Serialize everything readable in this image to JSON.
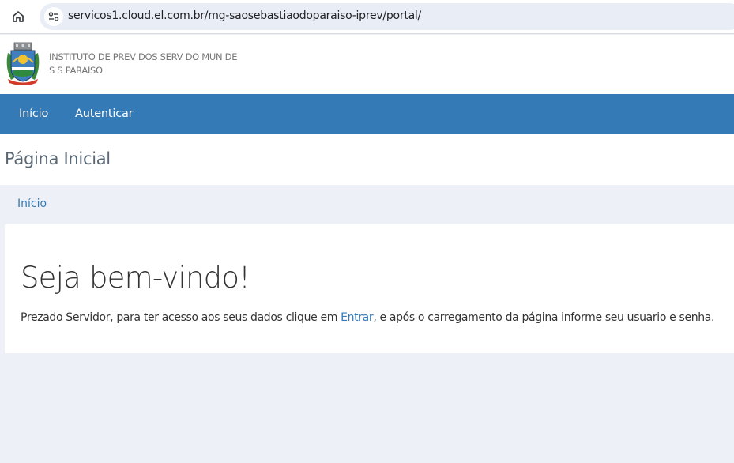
{
  "browser": {
    "url": "servicos1.cloud.el.com.br/mg-saosebastiaodoparaiso-iprev/portal/"
  },
  "header": {
    "org_name_line1": "INSTITUTO DE PREV DOS SERV DO MUN DE",
    "org_name_line2": "S S PARAISO"
  },
  "nav": {
    "items": [
      {
        "label": "Início"
      },
      {
        "label": "Autenticar"
      }
    ]
  },
  "page": {
    "title": "Página Inicial",
    "breadcrumb": "Início"
  },
  "welcome": {
    "heading": "Seja bem-vindo!",
    "text_before": "Prezado Servidor, para ter acesso aos seus dados clique em ",
    "link": "Entrar",
    "text_after": ", e após o carregamento da página informe seu usuario e senha."
  },
  "colors": {
    "navbar": "#337ab7",
    "link": "#337ab7",
    "background": "#edf1f7"
  }
}
